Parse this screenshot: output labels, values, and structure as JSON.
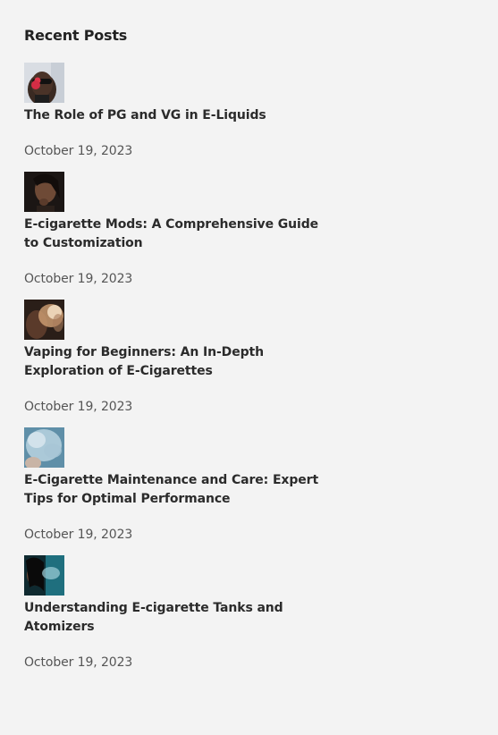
{
  "widget": {
    "title": "Recent Posts"
  },
  "posts": [
    {
      "title": "The Role of PG and VG in E-Liquids",
      "date": "October 19, 2023",
      "thumbnail": "man-with-sunglasses-vaping-photo"
    },
    {
      "title": "E-cigarette Mods: A Comprehensive Guide to Customization",
      "date": "October 19, 2023",
      "thumbnail": "woman-portrait-photo"
    },
    {
      "title": "Vaping for Beginners: An In-Depth Exploration of E-Cigarettes",
      "date": "October 19, 2023",
      "thumbnail": "person-exhaling-smoke-photo"
    },
    {
      "title": "E-Cigarette Maintenance and Care: Expert Tips for Optimal Performance",
      "date": "October 19, 2023",
      "thumbnail": "vapor-cloud-photo"
    },
    {
      "title": "Understanding E-cigarette Tanks and Atomizers",
      "date": "October 19, 2023",
      "thumbnail": "woman-vaping-blue-light-photo"
    }
  ]
}
